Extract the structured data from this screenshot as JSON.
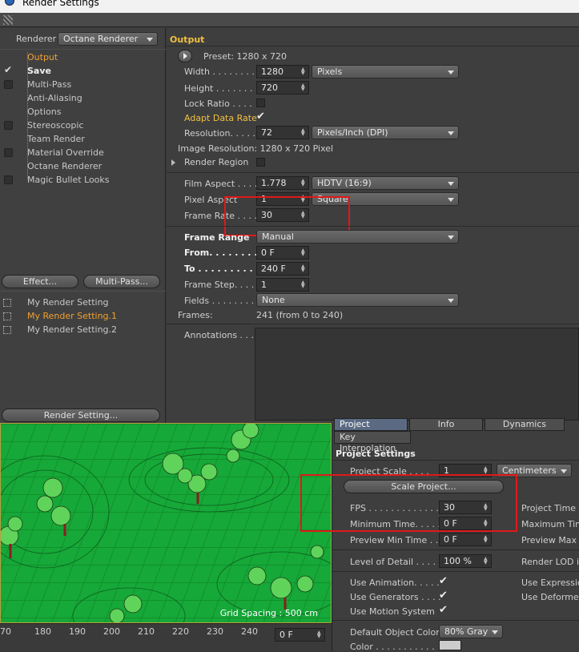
{
  "window": {
    "title": "Render Settings"
  },
  "left": {
    "renderer_label": "Renderer",
    "renderer_value": "Octane Renderer",
    "tree": [
      {
        "label": "Output",
        "state": "active",
        "check": "none"
      },
      {
        "label": "Save",
        "state": "bold",
        "check": "checked"
      },
      {
        "label": "Multi-Pass",
        "state": "normal",
        "check": "box"
      },
      {
        "label": "Anti-Aliasing",
        "state": "normal",
        "check": "none"
      },
      {
        "label": "Options",
        "state": "normal",
        "check": "none"
      },
      {
        "label": "Stereoscopic",
        "state": "normal",
        "check": "box"
      },
      {
        "label": "Team Render",
        "state": "normal",
        "check": "none"
      },
      {
        "label": "Material Override",
        "state": "normal",
        "check": "box"
      },
      {
        "label": "Octane Renderer",
        "state": "normal",
        "check": "none"
      },
      {
        "label": "Magic Bullet Looks",
        "state": "normal",
        "check": "box"
      }
    ],
    "effect_button": "Effect...",
    "multipass_button": "Multi-Pass...",
    "render_settings": [
      {
        "label": "My Render Setting",
        "active": false
      },
      {
        "label": "My Render Setting.1",
        "active": true
      },
      {
        "label": "My Render Setting.2",
        "active": false
      }
    ],
    "render_setting_button": "Render Setting..."
  },
  "output": {
    "header": "Output",
    "preset": "Preset: 1280 x 720",
    "width_label": "Width . . . . . . . . .",
    "width_value": "1280",
    "width_unit": "Pixels",
    "height_label": "Height . . . . . . . .",
    "height_value": "720",
    "lock_ratio_label": "Lock Ratio . . . .",
    "adapt_label": "Adapt Data Rate",
    "resolution_label": "Resolution. . . . . .",
    "resolution_value": "72",
    "resolution_unit": "Pixels/Inch (DPI)",
    "image_resolution": "Image Resolution: 1280 x 720 Pixel",
    "render_region_label": "Render Region",
    "film_aspect_label": "Film Aspect . . . .",
    "film_aspect_value": "1.778",
    "film_aspect_preset": "HDTV (16:9)",
    "pixel_aspect_label": "Pixel Aspect",
    "pixel_aspect_value": "1",
    "pixel_aspect_preset": "Square",
    "frame_rate_label": "Frame Rate . . . . .",
    "frame_rate_value": "30",
    "frame_range_label": "Frame Range",
    "frame_range_value": "Manual",
    "from_label": "From. . . . . . . . . .",
    "from_value": "0 F",
    "to_label": "To . . . . . . . . . . .",
    "to_value": "240 F",
    "frame_step_label": "Frame Step. . . . .",
    "frame_step_value": "1",
    "fields_label": "Fields . . . . . . . . .",
    "fields_value": "None",
    "frames_label": "Frames:",
    "frames_value": "241 (from 0 to 240)",
    "annotations_label": "Annotations . . ."
  },
  "viewport": {
    "grid_spacing": "Grid Spacing : 500 cm",
    "ticks": [
      "70",
      "180",
      "190",
      "200",
      "210",
      "220",
      "230",
      "240"
    ],
    "frame_field": "0 F"
  },
  "project": {
    "tabs": [
      "Project Settings",
      "Info",
      "Dynamics"
    ],
    "key_interp_tab": "Key Interpolation",
    "header": "Project Settings",
    "scale_label": "Project Scale . . . .",
    "scale_value": "1",
    "scale_unit": "Centimeters",
    "scale_button": "Scale Project...",
    "fps_label": "FPS . . . . . . . . . . . . .",
    "fps_value": "30",
    "project_time_label": "Project Time . .",
    "min_time_label": "Minimum Time. . . . .",
    "min_time_value": "0 F",
    "max_time_label": "Maximum Time",
    "preview_min_label": "Preview Min Time . . .",
    "preview_min_value": "0 F",
    "preview_max_label": "Preview Max Ti",
    "lod_label": "Level of Detail . . . . .",
    "lod_value": "100 %",
    "render_lod_label": "Render LOD in",
    "use_animation_label": "Use Animation. . . . .",
    "use_expression_label": "Use Expression",
    "use_generators_label": "Use Generators . . . .",
    "use_deformers_label": "Use Deformers",
    "use_motion_label": "Use Motion System",
    "default_color_label": "Default Object Color",
    "default_color_value": "80% Gray",
    "color_label": "Color . . . . . . . . . . ."
  },
  "colors": {
    "highlight": "#f0a030",
    "annotation_red": "#e01818",
    "viewport_green": "#16a838"
  }
}
